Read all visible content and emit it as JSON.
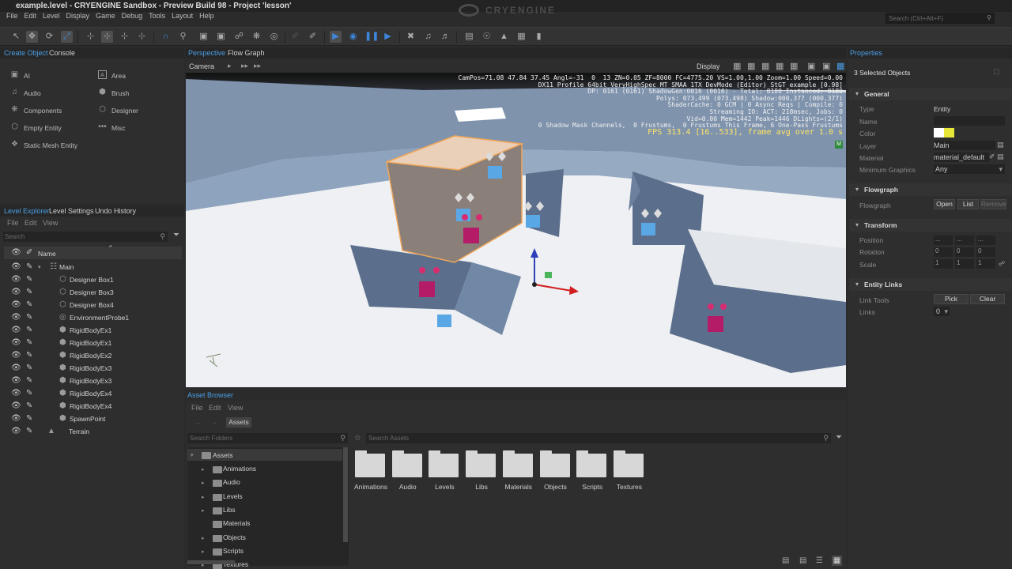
{
  "window": {
    "title": "example.level - CRYENGINE Sandbox - Preview Build 98 - Project 'lesson'",
    "logo_text": "CRYENGINE",
    "search_placeholder": "Search (Ctrl+Alt+F)"
  },
  "menu": [
    "File",
    "Edit",
    "Level",
    "Display",
    "Game",
    "Debug",
    "Tools",
    "Layout",
    "Help"
  ],
  "create_object": {
    "tabs": [
      "Create Object",
      "Console"
    ],
    "items_left": [
      "AI",
      "Audio",
      "Components",
      "Empty Entity",
      "Static Mesh Entity"
    ],
    "items_right": [
      "Area",
      "Brush",
      "Designer",
      "Misc"
    ]
  },
  "level_explorer": {
    "tabs": [
      "Level Explorer",
      "Level Settings",
      "Undo History"
    ],
    "menu": [
      "File",
      "Edit",
      "View"
    ],
    "search_placeholder": "Search",
    "column_name": "Name",
    "rows": [
      {
        "label": "Main",
        "icon": "layer-icon"
      },
      {
        "label": "Designer Box1",
        "icon": "designer-icon"
      },
      {
        "label": "Designer Box3",
        "icon": "designer-icon"
      },
      {
        "label": "Designer Box4",
        "icon": "designer-icon"
      },
      {
        "label": "EnvironmentProbe1",
        "icon": "probe-icon"
      },
      {
        "label": "RigidBodyEx1",
        "icon": "rigidbody-icon"
      },
      {
        "label": "RigidBodyEx1",
        "icon": "rigidbody-icon"
      },
      {
        "label": "RigidBodyEx2",
        "icon": "rigidbody-icon"
      },
      {
        "label": "RigidBodyEx3",
        "icon": "rigidbody-icon"
      },
      {
        "label": "RigidBodyEx3",
        "icon": "rigidbody-icon"
      },
      {
        "label": "RigidBodyEx4",
        "icon": "rigidbody-icon"
      },
      {
        "label": "RigidBodyEx4",
        "icon": "rigidbody-icon"
      },
      {
        "label": "SpawnPoint",
        "icon": "spawn-icon"
      },
      {
        "label": "Terrain",
        "icon": "terrain-icon"
      }
    ]
  },
  "viewport": {
    "tabs": [
      "Perspective",
      "Flow Graph"
    ],
    "camera_label": "Camera",
    "display_label": "Display",
    "info_lines": [
      "CamPos=71.08 47.84 37.45 Angl=-31  0  13 ZN=0.05 ZF=8000 FC=4775.20 VS=1.00,1.00 Zoom=1.00 Speed=0.00",
      "DX11 Profile 64bit VeryHighSpec MT SMAA 1TX DevMode (Editor) StGT example [0.98]",
      "DP: 0161 (0161) ShadowGen:0016 (0016) - Total: 0180 Instanced: 0180",
      "Polys: 073,499 (073,498) Shadow:000,377 (000,377)",
      "ShaderCache: 0 GCM | 0 Async Reqs | Compile: 0",
      "Streaming IO: ACT: 218msec, Jobs: 0",
      "Vid=0.00 Mem=1442 Peak=1446 DLights=(2/1)",
      "0 Shadow Mask Channels,  0 Frustums,  0 Frustums This Frame, 6 One-Pass Frustums"
    ],
    "fps_line": "FPS 313.4 [16..533], frame avg over 1.0 s",
    "badge": "M"
  },
  "properties": {
    "title": "Properties",
    "selected": "3 Selected Objects",
    "general_title": "General",
    "general": [
      {
        "label": "Type",
        "value": "Entity"
      },
      {
        "label": "Name",
        "value": ""
      },
      {
        "label": "Color",
        "value": ""
      },
      {
        "label": "Layer",
        "value": "Main"
      },
      {
        "label": "Material",
        "value": "material_default"
      },
      {
        "label": "Minimum Graphics",
        "value": "Any"
      }
    ],
    "flowgraph_title": "Flowgraph",
    "flowgraph_label": "Flowgraph",
    "flowgraph_buttons": [
      "Open",
      "List",
      "Remove"
    ],
    "transform_title": "Transform",
    "transform": [
      {
        "label": "Position",
        "values": [
          "...",
          "...",
          "..."
        ]
      },
      {
        "label": "Rotation",
        "values": [
          "0",
          "0",
          "0"
        ]
      },
      {
        "label": "Scale",
        "values": [
          "1",
          "1",
          "1"
        ]
      }
    ],
    "entity_links_title": "Entity Links",
    "link_tools_label": "Link Tools",
    "link_buttons": [
      "Pick",
      "Clear"
    ],
    "links_label": "Links",
    "links_value": "0"
  },
  "asset_browser": {
    "title": "Asset Browser",
    "menu": [
      "File",
      "Edit",
      "View"
    ],
    "breadcrumb": "Assets",
    "search_folders": "Search Folders",
    "search_assets": "Search Assets",
    "tree_root": "Assets",
    "tree": [
      "Animations",
      "Audio",
      "Levels",
      "Libs",
      "Materials",
      "Objects",
      "Scripts",
      "Textures"
    ],
    "tiles": [
      "Animations",
      "Audio",
      "Levels",
      "Libs",
      "Materials",
      "Objects",
      "Scripts",
      "Textures"
    ]
  },
  "colors": {
    "accent": "#4a9fe6",
    "fps": "#ffe566",
    "selection": "#f0a65a"
  }
}
